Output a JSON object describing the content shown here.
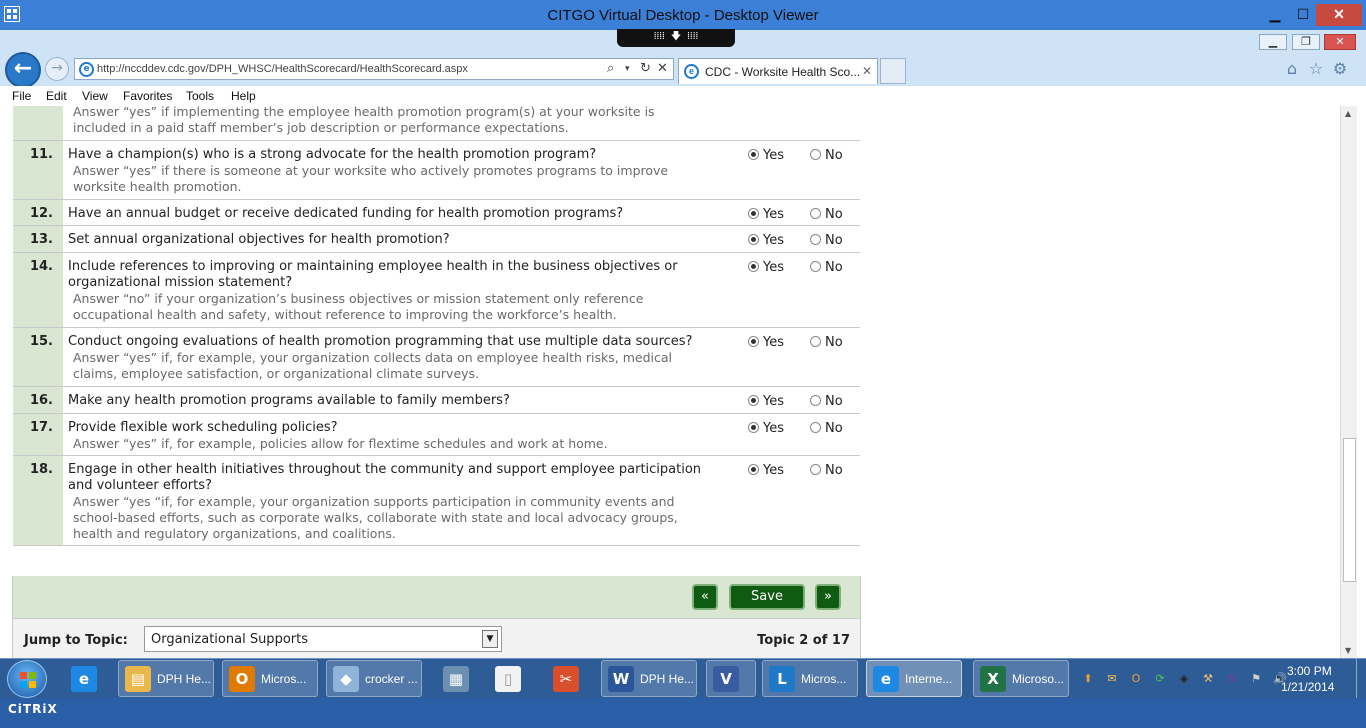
{
  "outer_window": {
    "title": "CITGO Virtual Desktop - Desktop Viewer",
    "min_label": "▁",
    "max_label": "☐",
    "close_label": "✕",
    "citrix_tab": "⁞⁞⁞⁞ 🡇 ⁞⁞⁞⁞"
  },
  "browser": {
    "url": "http://nccddev.cdc.gov/DPH_WHSC/HealthScorecard/HealthScorecard.aspx",
    "tab_title": "CDC - Worksite Health Sco...",
    "min_label": "▁",
    "max_label": "❐",
    "close_label": "✕",
    "back_icon": "←",
    "forward_icon": "→",
    "search_icon": "⌕",
    "dropdown_icon": "▾",
    "refresh_icon": "↻",
    "stop_icon": "✕",
    "tab_close_icon": "✕",
    "home_icon": "⌂",
    "favorites_icon": "☆",
    "tools_icon": "⚙",
    "ie_letter": "e"
  },
  "menubar": {
    "file": "File",
    "edit": "Edit",
    "view": "View",
    "favorites": "Favorites",
    "tools": "Tools",
    "help": "Help"
  },
  "questions": [
    {
      "number": "",
      "text": "",
      "hint": "Answer “yes” if implementing the employee health promotion program(s) at your worksite is included in a paid staff member’s job description or performance expectations.",
      "answer": "",
      "show_radios": false
    },
    {
      "number": "11.",
      "text": "Have a champion(s) who is a strong advocate for the health promotion program?",
      "hint": "Answer “yes” if there is someone at your worksite who actively promotes programs to improve worksite health promotion.",
      "answer": "Yes"
    },
    {
      "number": "12.",
      "text": "Have an annual budget or receive dedicated funding for health promotion programs?",
      "hint": "",
      "answer": "Yes"
    },
    {
      "number": "13.",
      "text": "Set annual organizational objectives for health promotion?",
      "hint": "",
      "answer": "Yes"
    },
    {
      "number": "14.",
      "text": "Include references to improving or maintaining employee health in the business objectives or organizational mission statement?",
      "hint": "Answer “no” if your organization’s business objectives or mission statement only reference occupational health and safety, without reference to improving the workforce’s health.",
      "answer": "Yes"
    },
    {
      "number": "15.",
      "text": "Conduct ongoing evaluations of health promotion programming that use multiple data sources?",
      "hint": "Answer “yes” if, for example, your organization collects data on employee health risks, medical claims, employee satisfaction, or organizational climate surveys.",
      "answer": "Yes"
    },
    {
      "number": "16.",
      "text": "Make any health promotion programs available to family members?",
      "hint": "",
      "answer": "Yes"
    },
    {
      "number": "17.",
      "text": "Provide flexible work scheduling policies?",
      "hint": "Answer “yes” if, for example, policies allow for flextime schedules and work at home.",
      "answer": "Yes"
    },
    {
      "number": "18.",
      "text": "Engage in other health initiatives throughout the community and support employee participation and volunteer efforts?",
      "hint": "Answer “yes “if, for example, your organization supports participation in community events and school-based efforts, such as corporate walks, collaborate with state and local advocacy groups, health and regulatory organizations, and coalitions.",
      "answer": "Yes"
    }
  ],
  "radio_labels": {
    "yes": "Yes",
    "no": "No"
  },
  "nav": {
    "prev_label": "«",
    "save_label": "Save",
    "next_label": "»"
  },
  "jump": {
    "label": "Jump to Topic:",
    "selected": "Organizational Supports",
    "arrow": "▼",
    "topic_counter": "Topic 2 of 17"
  },
  "taskbar": {
    "items": [
      {
        "name": "ie-pinned",
        "label": "",
        "icon": "e",
        "color": "#1e88e5",
        "style": ""
      },
      {
        "name": "explorer-dph",
        "label": "DPH He...",
        "icon": "▤",
        "color": "#e8b84a",
        "style": "win"
      },
      {
        "name": "outlook",
        "label": "Micros...",
        "icon": "O",
        "color": "#e07b00",
        "style": "win"
      },
      {
        "name": "crocker",
        "label": "crocker ...",
        "icon": "◆",
        "color": "#8fb3d9",
        "style": "win"
      },
      {
        "name": "calculator",
        "label": "",
        "icon": "▦",
        "color": "#6d8fb0",
        "style": ""
      },
      {
        "name": "blank-doc",
        "label": "",
        "icon": "▯",
        "color": "#f2f2f2",
        "style": ""
      },
      {
        "name": "snipping",
        "label": "",
        "icon": "✂",
        "color": "#d94f2b",
        "style": ""
      },
      {
        "name": "word-dph",
        "label": "DPH He...",
        "icon": "W",
        "color": "#2b579a",
        "style": "win"
      },
      {
        "name": "visio",
        "label": "",
        "icon": "V",
        "color": "#3a5ba0",
        "style": "win"
      },
      {
        "name": "lync",
        "label": "Micros...",
        "icon": "L",
        "color": "#1f78c8",
        "style": "win"
      },
      {
        "name": "ie-window",
        "label": "Interne...",
        "icon": "e",
        "color": "#1e88e5",
        "style": "active"
      },
      {
        "name": "excel",
        "label": "Microso...",
        "icon": "X",
        "color": "#217346",
        "style": "win"
      }
    ],
    "tray": [
      {
        "name": "tray-up-icon",
        "glyph": "⬆",
        "color": "#f0a030"
      },
      {
        "name": "tray-mail-icon",
        "glyph": "✉",
        "color": "#f5c542"
      },
      {
        "name": "tray-outlook-icon",
        "glyph": "O",
        "color": "#f0a030"
      },
      {
        "name": "tray-sync-icon",
        "glyph": "⟳",
        "color": "#4fc34f"
      },
      {
        "name": "tray-network-icon",
        "glyph": "◈",
        "color": "#222222"
      },
      {
        "name": "tray-tool-icon",
        "glyph": "⚒",
        "color": "#e8c070"
      },
      {
        "name": "tray-onenote-icon",
        "glyph": "N",
        "color": "#7b3b9e"
      },
      {
        "name": "tray-flag-icon",
        "glyph": "⚑",
        "color": "#d0d0d0"
      },
      {
        "name": "tray-volume-icon",
        "glyph": "🔊",
        "color": "#ffffff"
      }
    ],
    "time": "3:00 PM",
    "date": "1/21/2014"
  },
  "citrix": {
    "logo": "CiTRiX"
  }
}
